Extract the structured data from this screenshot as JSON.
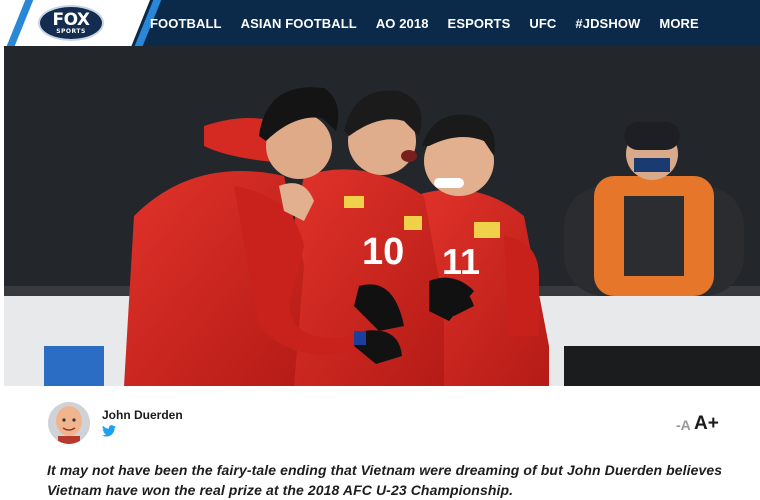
{
  "header": {
    "logo": {
      "main": "FOX",
      "sub": "SPORTS"
    },
    "menu": [
      "FOOTBALL",
      "ASIAN FOOTBALL",
      "AO 2018",
      "ESPORTS",
      "UFC",
      "#JDSHOW",
      "MORE"
    ]
  },
  "hero": {
    "jersey_numbers": [
      "10",
      "11"
    ]
  },
  "article": {
    "author": "John Duerden",
    "font_size_controls": {
      "decrease": "-A",
      "increase": "A+"
    },
    "intro": "It may not have been the fairy-tale ending that Vietnam were dreaming of but John Duerden believes Vietnam have won the real prize at the 2018 AFC U-23 Championship."
  },
  "colors": {
    "nav_background": "#0b2949",
    "nav_accent": "#2a86d6",
    "jersey_red": "#d8261f"
  },
  "icons": [
    "twitter-icon",
    "avatar"
  ]
}
